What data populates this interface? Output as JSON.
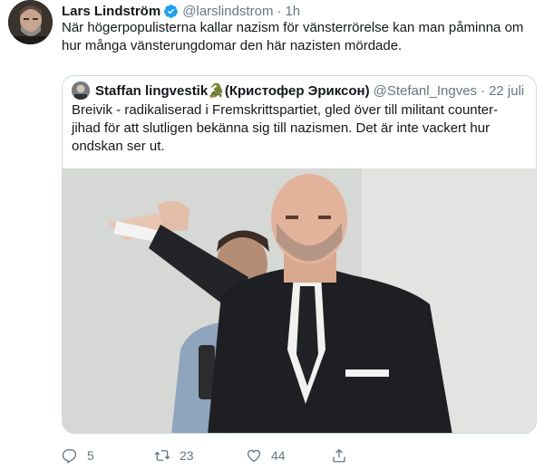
{
  "tweet": {
    "author_name": "Lars Lindström",
    "handle": "@larslindstrom",
    "separator": "·",
    "time": "1h",
    "text": "När högerpopulisterna kallar nazism för vänsterrörelse kan man påminna om hur många vänsterungdomar den här nazisten mördade."
  },
  "quoted": {
    "author_name": "Staffan lingvestik🐊(Кристофер Эриксон)",
    "handle": "@Stefanl_Ingves",
    "separator": "·",
    "time": "22 juli",
    "text": "Breivik - radikaliserad i Fremskrittspartiet, gled över till militant counter-jihad för att slutligen bekänna sig till nazismen. Det är inte vackert hur ondskan ser ut."
  },
  "actions": {
    "reply_count": "5",
    "retweet_count": "23",
    "like_count": "44"
  },
  "icons": {
    "verified": "verified-badge-icon",
    "reply": "reply-icon",
    "retweet": "retweet-icon",
    "like": "heart-icon",
    "share": "share-icon"
  },
  "colors": {
    "verified_blue": "#1da1f2",
    "secondary_text": "#657786",
    "border": "#cfd9de"
  }
}
